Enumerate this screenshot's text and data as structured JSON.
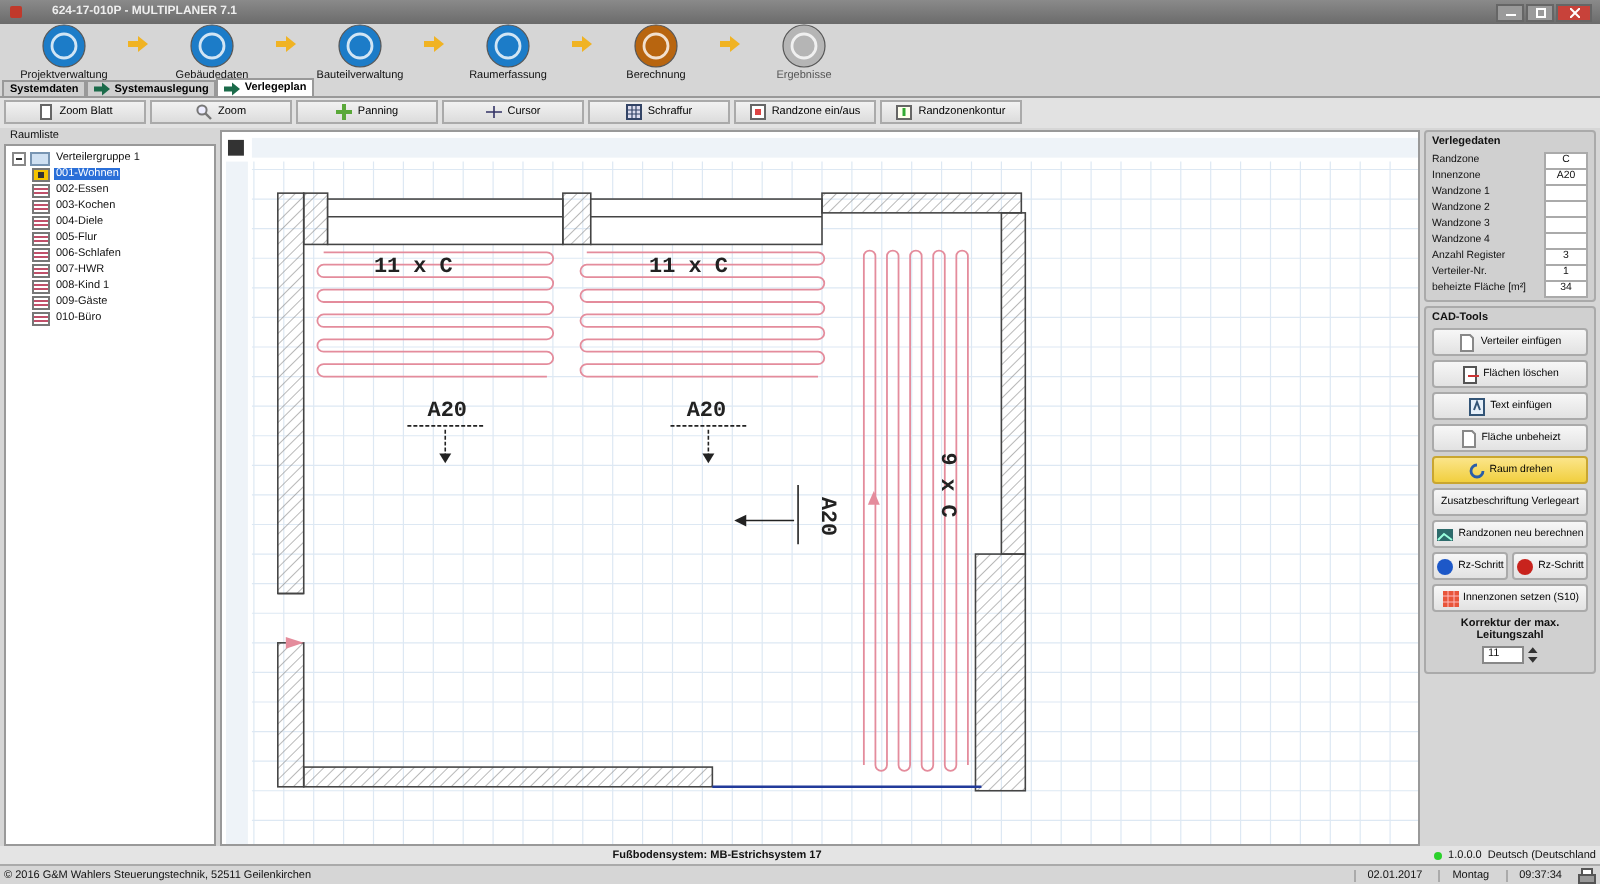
{
  "window": {
    "title": "624-17-010P - MULTIPLANER 7.1"
  },
  "steps": [
    {
      "label": "Projektverwaltung",
      "color": "#1c7cc8",
      "disabled": false
    },
    {
      "label": "Gebäudedaten",
      "color": "#1c7cc8",
      "disabled": false
    },
    {
      "label": "Bauteilverwaltung",
      "color": "#1c7cc8",
      "disabled": false
    },
    {
      "label": "Raumerfassung",
      "color": "#1c7cc8",
      "disabled": false
    },
    {
      "label": "Berechnung",
      "color": "#b8650f",
      "disabled": false
    },
    {
      "label": "Ergebnisse",
      "color": "#b5b5b5",
      "disabled": true
    }
  ],
  "tabs": [
    {
      "label": "Systemdaten",
      "kind": "plain",
      "selected": false
    },
    {
      "label": "Systemauslegung",
      "kind": "arrow",
      "selected": false
    },
    {
      "label": "Verlegeplan",
      "kind": "arrow",
      "selected": true
    }
  ],
  "toolbar": [
    {
      "label": "Zoom Blatt",
      "kind": "page"
    },
    {
      "label": "Zoom",
      "kind": "magnifier"
    },
    {
      "label": "Panning",
      "kind": "move"
    },
    {
      "label": "Cursor",
      "kind": "cross"
    },
    {
      "label": "Schraffur",
      "kind": "hatch"
    },
    {
      "label": "Randzone ein/aus",
      "kind": "frame"
    },
    {
      "label": "Randzonenkontur",
      "kind": "contour"
    }
  ],
  "room_list": {
    "title": "Raumliste",
    "group": {
      "label": "Verteilergruppe 1",
      "expanded": true,
      "children": [
        {
          "label": "001-Wohnen",
          "selected": true
        },
        {
          "label": "002-Essen",
          "selected": false
        },
        {
          "label": "003-Kochen",
          "selected": false
        },
        {
          "label": "004-Diele",
          "selected": false
        },
        {
          "label": "005-Flur",
          "selected": false
        },
        {
          "label": "006-Schlafen",
          "selected": false
        },
        {
          "label": "007-HWR",
          "selected": false
        },
        {
          "label": "008-Kind 1",
          "selected": false
        },
        {
          "label": "009-Gäste",
          "selected": false
        },
        {
          "label": "010-Büro",
          "selected": false
        }
      ]
    }
  },
  "plan": {
    "texts": [
      {
        "label": "11 x C",
        "kind": "loop"
      },
      {
        "label": "11 x C",
        "kind": "loop"
      },
      {
        "label": "A20",
        "kind": "zone"
      },
      {
        "label": "A20",
        "kind": "zone"
      },
      {
        "label": "A20",
        "kind": "zone-vertical"
      },
      {
        "label": "9 x C",
        "kind": "loop-vertical"
      }
    ]
  },
  "installation_data": {
    "title": "Verlegedaten",
    "fields": [
      {
        "label": "Randzone",
        "value": "C"
      },
      {
        "label": "Innenzone",
        "value": "A20"
      },
      {
        "label": "Wandzone 1"
      },
      {
        "label": "Wandzone 2"
      },
      {
        "label": "Wandzone 3"
      },
      {
        "label": "Wandzone 4"
      },
      {
        "label": "Anzahl Register",
        "value": "3"
      },
      {
        "label": "Verteiler-Nr.",
        "value": "1"
      },
      {
        "label": "beheizte Fläche [m²]",
        "value": "34"
      }
    ]
  },
  "cad_tools": {
    "title": "CAD-Tools",
    "rows": [
      [
        {
          "label": "Verteiler einfügen",
          "kind": "page",
          "selected": false
        }
      ],
      [
        {
          "label": "Flächen löschen",
          "kind": "delete",
          "selected": false
        }
      ],
      [
        {
          "label": "Text einfügen",
          "kind": "text",
          "selected": false
        }
      ],
      [
        {
          "label": "Fläche unbeheizt",
          "kind": "page",
          "selected": false
        }
      ],
      [
        {
          "label": "Raum drehen",
          "kind": "rotate",
          "selected": true
        }
      ],
      [
        {
          "label": "Zusatzbeschriftung Verlegeart",
          "kind": "none",
          "selected": false
        }
      ],
      [
        {
          "label": "Randzonen neu berechnen",
          "kind": "image",
          "selected": false
        }
      ],
      [
        {
          "label": "Rz-Schritt",
          "kind": "ball-blue",
          "selected": false
        },
        {
          "label": "Rz-Schritt",
          "kind": "ball-red",
          "selected": false
        }
      ],
      [
        {
          "label": "Innenzonen setzen  (S10)",
          "kind": "grid",
          "selected": false
        }
      ]
    ]
  },
  "correction": {
    "label": "Korrektur der max. Leitungszahl",
    "value": "11"
  },
  "status": {
    "system": "Fußbodensystem: MB-Estrichsystem 17",
    "version": "1.0.0.0",
    "language": "Deutsch (Deutschland",
    "copyright": "© 2016 G&M Wahlers Steuerungstechnik, 52511 Geilenkirchen",
    "date": "02.01.2017",
    "weekday": "Montag",
    "time": "09:37:34"
  }
}
